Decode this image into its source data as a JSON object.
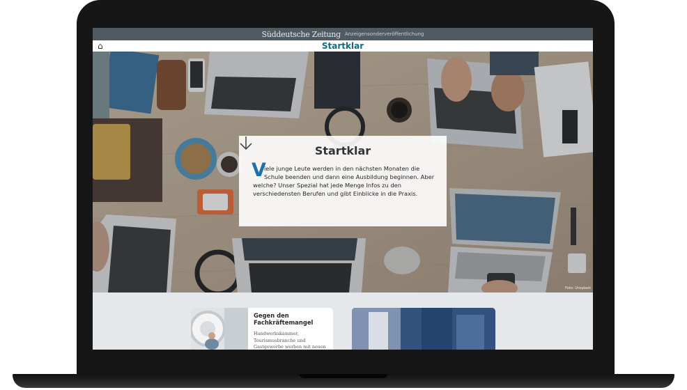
{
  "header": {
    "brand": "Süddeutsche Zeitung",
    "note": "Anzeigensonderveröffentlichung",
    "logo": "Startklar",
    "home_icon": "home-icon"
  },
  "hero": {
    "title": "Startklar",
    "dropcap": "V",
    "intro_lines": [
      "iele junge Leute werden in den nächsten Monaten die",
      "Schule beenden und dann eine Ausbildung beginnen. Aber",
      "welche? Unser Spezial hat jede Menge Infos zu den",
      "verschiedensten Berufen und gibt Einblicke in die Praxis."
    ],
    "arrow_icon": "arrow-down-icon",
    "credit": "Foto: Unsplash"
  },
  "teasers": [
    {
      "title_lines": [
        "Gegen den",
        "Fachkräftemangel"
      ],
      "text_lines": [
        "Handwerkskammer,",
        "Tourismusbranche und",
        "Gastgewerbe werben mit neuen"
      ]
    }
  ],
  "colors": {
    "sz_bar": "#4f5a62",
    "logo": "#0b6f8a",
    "dropcap": "#1f6fa8",
    "lower_bg": "#e4e8eb"
  }
}
